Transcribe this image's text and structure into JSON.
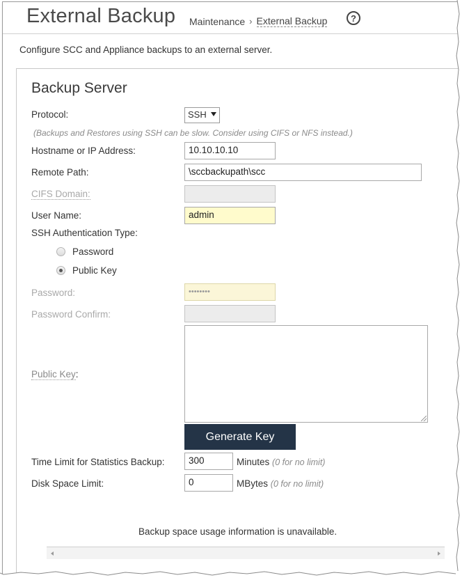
{
  "header": {
    "title": "External Backup",
    "breadcrumb": [
      "Maintenance",
      "External Backup"
    ],
    "breadcrumb_separator": "›",
    "help_icon": "question-circle-icon"
  },
  "description": "Configure SCC and Appliance backups to an external server.",
  "backup_server": {
    "heading": "Backup Server",
    "protocol": {
      "label": "Protocol:",
      "value": "SSH"
    },
    "hint": "(Backups and Restores using SSH can be slow. Consider using CIFS or NFS instead.)",
    "hostname": {
      "label": "Hostname or IP Address:",
      "value": "10.10.10.10"
    },
    "remote_path": {
      "label": "Remote Path:",
      "value": "\\sccbackupath\\scc"
    },
    "cifs_domain": {
      "label": "CIFS Domain:",
      "value": ""
    },
    "user_name": {
      "label": "User Name:",
      "value": "admin"
    },
    "ssh_auth": {
      "label": "SSH Authentication Type:",
      "options": [
        {
          "label": "Password",
          "checked": false
        },
        {
          "label": "Public Key",
          "checked": true
        }
      ]
    },
    "password": {
      "label": "Password:",
      "value": "••••••••"
    },
    "password_confirm": {
      "label": "Password Confirm:",
      "value": ""
    },
    "public_key": {
      "label_link": "Public Key",
      "label_suffix": ":",
      "value": ""
    },
    "generate_key_button": "Generate Key",
    "stats_time_limit": {
      "label": "Time Limit for Statistics Backup:",
      "value": "300",
      "unit": "Minutes",
      "note": "(0 for no limit)"
    },
    "disk_space_limit": {
      "label": "Disk Space Limit:",
      "value": "0",
      "unit": "MBytes",
      "note": "(0 for no limit)"
    },
    "usage_message": "Backup space usage information is unavailable."
  },
  "colors": {
    "button_bg": "#243447",
    "highlight_input": "#fffbcc"
  }
}
